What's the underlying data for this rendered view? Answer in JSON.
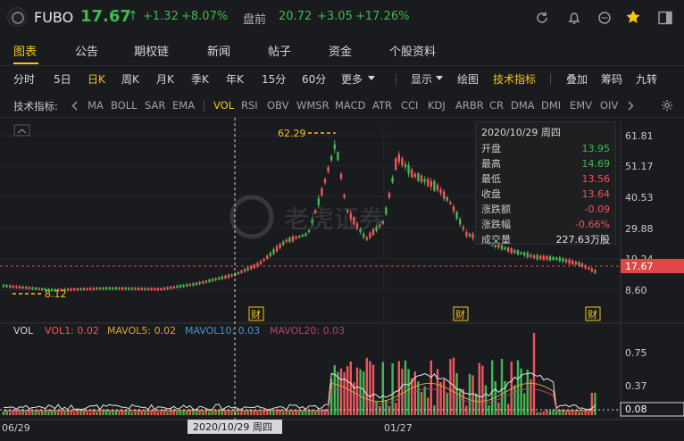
{
  "header": {
    "ticker": "FUBO",
    "price": "17.67",
    "arrow": "↑",
    "change": "+1.32",
    "change_pct": "+8.07%",
    "premarket_label": "盘前",
    "premarket_price": "20.72",
    "premarket_change": "+3.05",
    "premarket_pct": "+17.26%",
    "icons": [
      "refresh-icon",
      "bell-icon",
      "star-icon",
      "sidebar-icon"
    ]
  },
  "tabs": [
    "图表",
    "公告",
    "期权链",
    "新闻",
    "帖子",
    "资金",
    "个股资料"
  ],
  "periods": {
    "items": [
      "分时",
      "5日",
      "日K",
      "周K",
      "月K",
      "季K",
      "年K",
      "15分",
      "60分",
      "更多"
    ],
    "active": "日K",
    "right": [
      "显示",
      "绘图",
      "技术指标",
      "叠加",
      "筹码",
      "九转"
    ],
    "right_active": "技术指标"
  },
  "indicators": {
    "label": "技术指标:",
    "items": [
      "MA",
      "BOLL",
      "SAR",
      "EMA",
      "VOL",
      "RSI",
      "OBV",
      "WMSR",
      "MACD",
      "ATR",
      "CCI",
      "KDJ",
      "ARBR",
      "CR",
      "DMA",
      "DMI",
      "EMV",
      "OIV"
    ],
    "active": "VOL"
  },
  "price_axis": {
    "ticks": [
      "61.81",
      "51.17",
      "40.53",
      "29.88",
      "19.24",
      "8.60"
    ],
    "current": "17.67",
    "high_marker": "62.29",
    "low_marker": "8.12",
    "earnings_badge": "财"
  },
  "tooltip": {
    "title": "2020/10/29 周四",
    "rows": [
      {
        "label": "开盘",
        "value": "13.95",
        "color": "green"
      },
      {
        "label": "最高",
        "value": "14.69",
        "color": "green"
      },
      {
        "label": "最低",
        "value": "13.56",
        "color": "red"
      },
      {
        "label": "收盘",
        "value": "13.64",
        "color": "red"
      },
      {
        "label": "涨跌额",
        "value": "-0.09",
        "color": "red"
      },
      {
        "label": "涨跌幅",
        "value": "-0.66%",
        "color": "red"
      },
      {
        "label": "成交量",
        "value": "227.63万股",
        "color": "white"
      }
    ]
  },
  "volume": {
    "title": "VOL",
    "vol1": "VOL1: 0.02",
    "mavol5": "MAVOL5: 0.02",
    "mavol10": "MAVOL10: 0.03",
    "mavol20": "MAVOL20: 0.03",
    "axis": [
      "0.75",
      "0.37",
      "0.08"
    ]
  },
  "xaxis": {
    "left": "06/29",
    "cursor_date": "2020/10/29 周四",
    "mid": "01/27"
  },
  "watermark": "老虎证券",
  "colors": {
    "up": "#3fb950",
    "down": "#f2545b",
    "accent": "#f5c518",
    "bg": "#1a1b1e"
  }
}
